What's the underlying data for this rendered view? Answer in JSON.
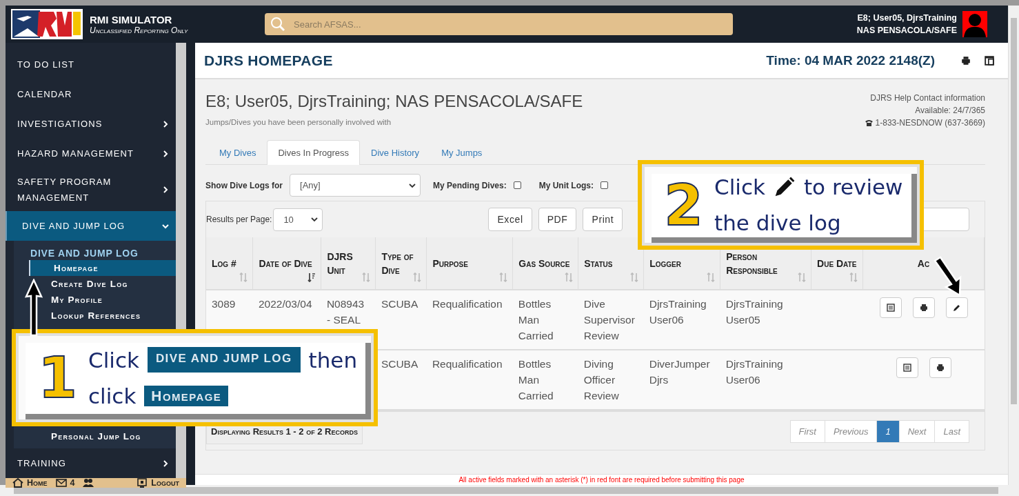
{
  "app": {
    "title": "RMI SIMULATOR",
    "subtitle": "Unclassified Reporting Only",
    "search_placeholder": "Search AFSAS...",
    "user_line1": "E8; User05, DjrsTraining",
    "user_line2": "NAS PENSACOLA/SAFE"
  },
  "sidebar": {
    "items": [
      {
        "label": "TO DO LIST",
        "has_submenu": false,
        "expanded": false
      },
      {
        "label": "CALENDAR",
        "has_submenu": false,
        "expanded": false
      },
      {
        "label": "INVESTIGATIONS",
        "has_submenu": true,
        "expanded": false
      },
      {
        "label": "HAZARD MANAGEMENT",
        "has_submenu": true,
        "expanded": false
      },
      {
        "label": "SAFETY PROGRAM MANAGEMENT",
        "has_submenu": true,
        "expanded": false
      },
      {
        "label": "DIVE AND JUMP LOG",
        "has_submenu": true,
        "expanded": true,
        "group_title": "DIVE AND JUMP LOG",
        "children": [
          {
            "label": "Homepage",
            "selected": true
          },
          {
            "label": "Create Dive Log",
            "selected": false
          },
          {
            "label": "My Profile",
            "selected": false
          },
          {
            "label": "Lookup References",
            "selected": false
          },
          {
            "label": "Personal Jump Log",
            "selected": false
          }
        ]
      },
      {
        "label": "TRAINING",
        "has_submenu": true,
        "expanded": false
      }
    ],
    "footer": {
      "home": "Home",
      "mail_count": "4",
      "logout": "Logout"
    }
  },
  "page": {
    "title": "DJRS HOMEPAGE",
    "time": "Time: 04 MAR 2022 2148(Z)",
    "user_heading": "E8; User05, DjrsTraining; NAS PENSACOLA/SAFE",
    "subtitle": "Jumps/Dives you have been personally involved with",
    "help": [
      "DJRS Help Contact information",
      "Available: 24/7/365",
      "1-833-NESDNOW (637-3669)"
    ],
    "tabs": [
      {
        "label": "My Dives",
        "selected": false
      },
      {
        "label": "Dives In Progress",
        "selected": true
      },
      {
        "label": "Dive History",
        "selected": false
      },
      {
        "label": "My Jumps",
        "selected": false
      }
    ],
    "filter": {
      "label": "Show Dive Logs for",
      "value": "[Any]"
    },
    "checkboxes": [
      {
        "label": "My Pending Dives:",
        "checked": false
      },
      {
        "label": "My Unit Logs:",
        "checked": false
      }
    ],
    "results_per_page": {
      "label": "Results per Page:",
      "value": "10"
    },
    "export_buttons": [
      "Excel",
      "PDF",
      "Print"
    ],
    "table": {
      "columns": [
        {
          "label": "Log #",
          "sorted": false
        },
        {
          "label": "Date of Dive",
          "sorted": true
        },
        {
          "label": "DJRS Unit",
          "sorted": false
        },
        {
          "label": "Type of Dive",
          "sorted": false
        },
        {
          "label": "Purpose",
          "sorted": false
        },
        {
          "label": "Gas Source",
          "sorted": false
        },
        {
          "label": "Status",
          "sorted": false
        },
        {
          "label": "Logger",
          "sorted": false
        },
        {
          "label": "Person Responsible",
          "sorted": false
        },
        {
          "label": "Due Date",
          "sorted": false
        },
        {
          "label": "Ac"
        }
      ],
      "rows": [
        {
          "cells": [
            "3089",
            "2022/03/04",
            "N08943 - SEAL",
            "SCUBA",
            "Requalification",
            "Bottles Man Carried",
            "Dive Supervisor Review",
            "DjrsTraining User06",
            "DjrsTraining User05",
            ""
          ],
          "actions": [
            {
              "kind": "view"
            },
            {
              "kind": "print"
            },
            {
              "kind": "edit"
            }
          ]
        },
        {
          "cells": [
            "",
            "",
            "",
            "SCUBA",
            "Requalification",
            "Bottles Man Carried",
            "Diving Officer Review",
            "DiverJumper Djrs",
            "DjrsTraining User06",
            ""
          ],
          "actions": [
            {
              "kind": "view"
            },
            {
              "kind": "print"
            }
          ]
        }
      ]
    },
    "record_count": "Displaying Results 1 - 2 of 2 Records",
    "pagination": [
      {
        "label": "First",
        "selected": false
      },
      {
        "label": "Previous",
        "selected": false
      },
      {
        "label": "1",
        "selected": true
      },
      {
        "label": "Next",
        "selected": false
      },
      {
        "label": "Last",
        "selected": false
      }
    ],
    "required_note": "All active fields marked with an asterisk (*) in red font are required before submitting this page"
  },
  "callouts": [
    {
      "number": "1",
      "segments": [
        {
          "kind": "text",
          "text": "Click"
        },
        {
          "kind": "chip",
          "text": "DIVE AND JUMP LOG"
        },
        {
          "kind": "text",
          "text": "then"
        },
        {
          "kind": "break"
        },
        {
          "kind": "text",
          "text": "click"
        },
        {
          "kind": "chip",
          "text": "Homepage"
        }
      ]
    },
    {
      "number": "2",
      "segments": [
        {
          "kind": "text",
          "text": "Click"
        },
        {
          "kind": "icon"
        },
        {
          "kind": "text",
          "text": "to review"
        },
        {
          "kind": "break"
        },
        {
          "kind": "text",
          "text": "the dive log"
        }
      ]
    }
  ]
}
